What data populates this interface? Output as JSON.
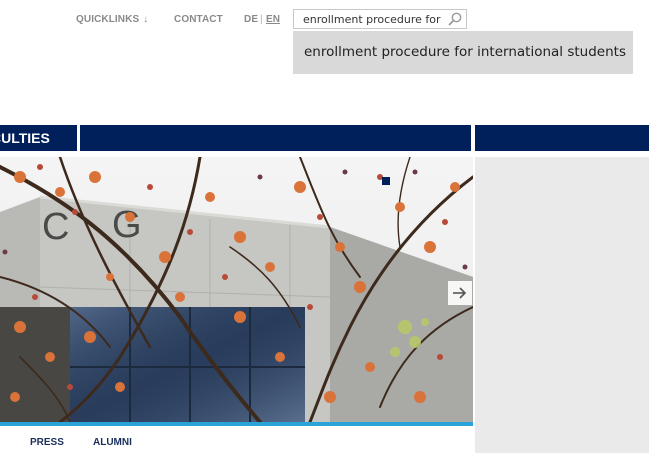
{
  "topbar": {
    "quicklinks_label": "QUICKLINKS",
    "contact_label": "CONTACT",
    "lang_de": "DE",
    "lang_separator": "|",
    "lang_en": "EN"
  },
  "search": {
    "value": "enrollment procedure for in",
    "icon": "search-icon"
  },
  "suggestion": {
    "text": "enrollment procedure for international students"
  },
  "nav": {
    "faculties_label": "CULTIES"
  },
  "bottom_nav": {
    "press_label": "PRESS",
    "alumni_label": "ALUMNI"
  },
  "colors": {
    "navy": "#00205b",
    "accent": "#2aa3d9",
    "panel": "#eaeaea"
  }
}
